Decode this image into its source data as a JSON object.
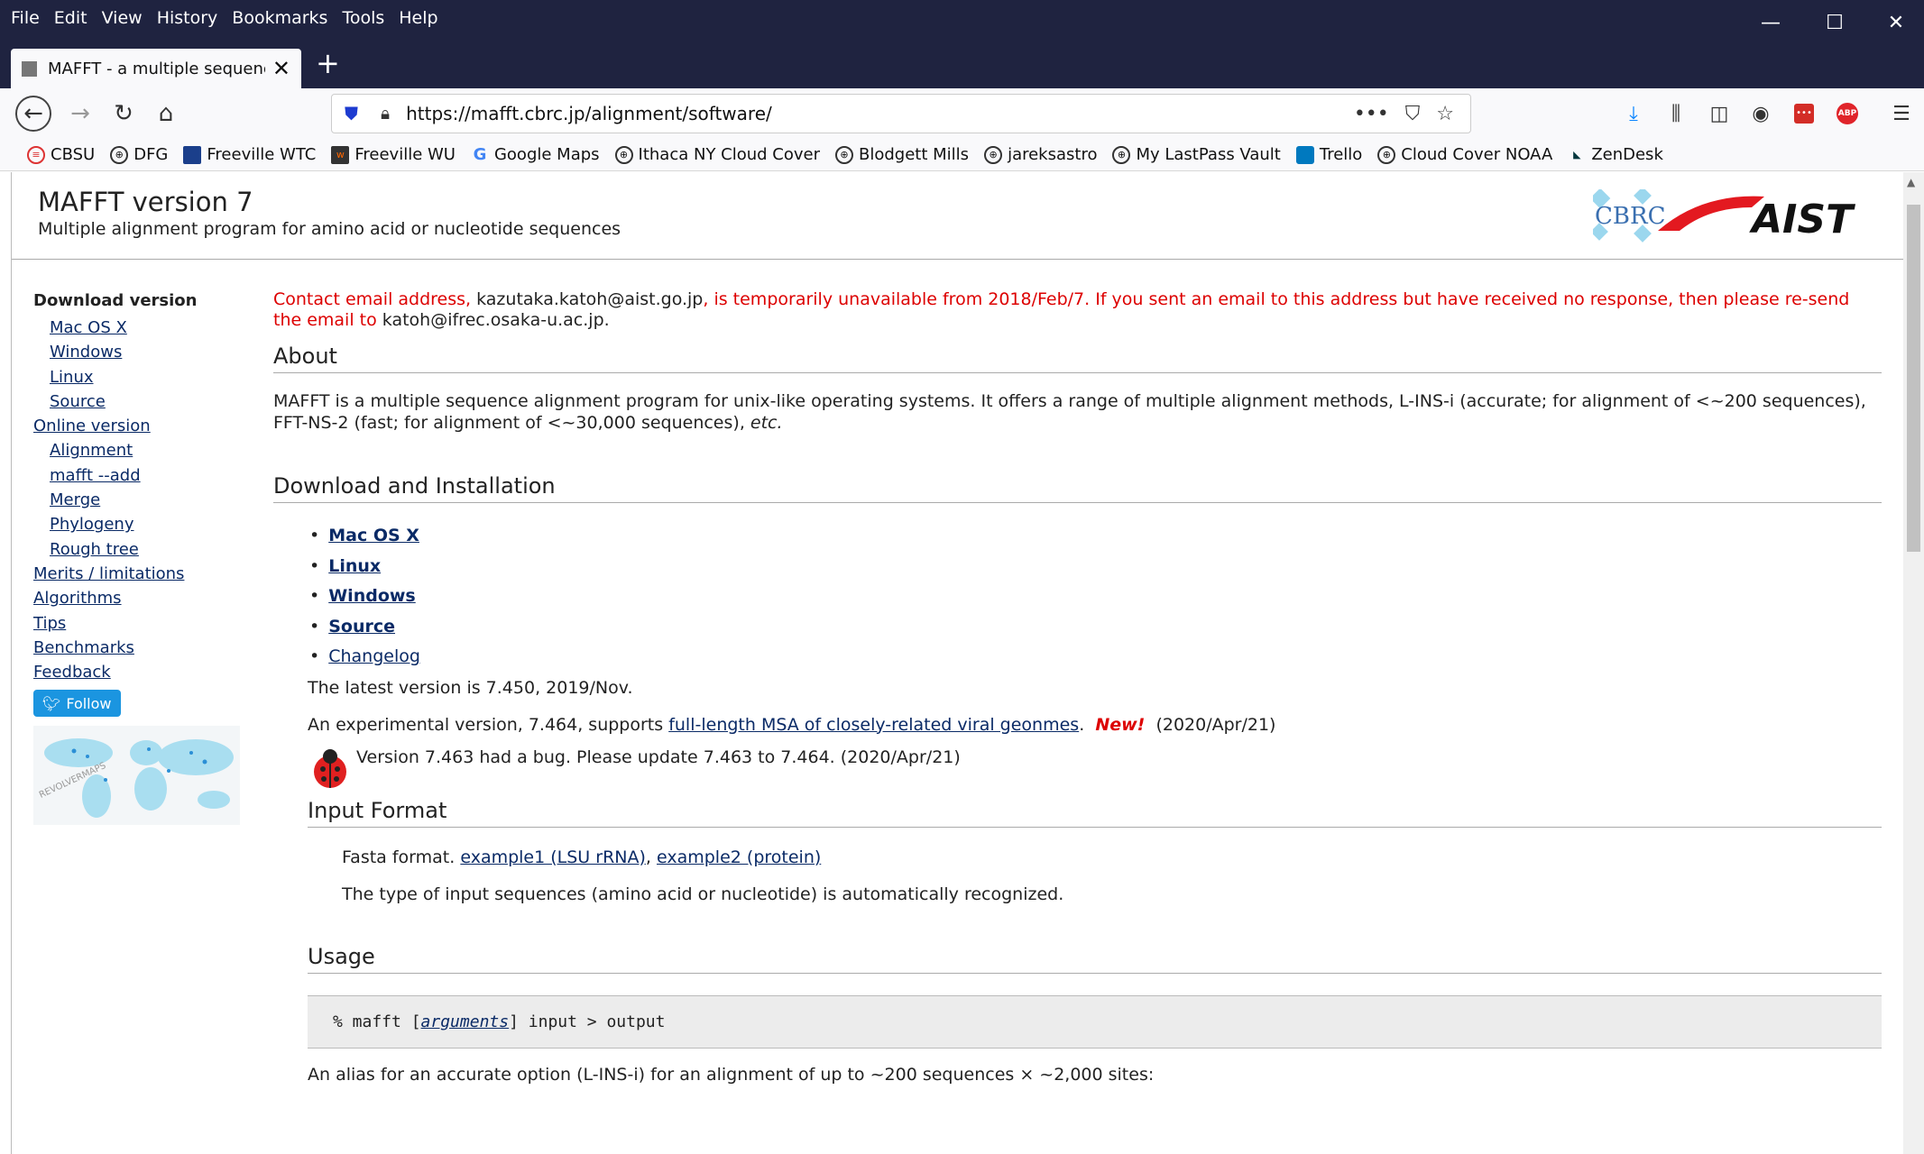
{
  "menu": [
    "File",
    "Edit",
    "View",
    "History",
    "Bookmarks",
    "Tools",
    "Help"
  ],
  "window_controls": {
    "minimize": "—",
    "maximize": "☐",
    "close": "✕"
  },
  "tab": {
    "title": "MAFFT - a multiple sequence a",
    "close": "✕",
    "new": "+"
  },
  "nav": {
    "url": "https://mafft.cbrc.jp/alignment/software/",
    "back": "←",
    "forward": "→",
    "reload": "↻",
    "home": "⌂",
    "more": "•••",
    "pocket": "⛉",
    "star": "☆"
  },
  "toolbar_icons": [
    "download-icon",
    "library-icon",
    "sidebar-icon",
    "account-icon",
    "lastpass-icon",
    "adblock-icon",
    "menu-icon"
  ],
  "bookmarks": [
    {
      "label": "CBSU"
    },
    {
      "label": "DFG"
    },
    {
      "label": "Freeville WTC"
    },
    {
      "label": "Freeville WU"
    },
    {
      "label": "Google Maps"
    },
    {
      "label": "Ithaca NY Cloud Cover"
    },
    {
      "label": "Blodgett Mills"
    },
    {
      "label": "jareksastro"
    },
    {
      "label": "My LastPass Vault"
    },
    {
      "label": "Trello"
    },
    {
      "label": "Cloud Cover NOAA"
    },
    {
      "label": "ZenDesk"
    }
  ],
  "header": {
    "title": "MAFFT version 7",
    "subtitle": "Multiple alignment program for amino acid or nucleotide sequences",
    "logo_left": "CBRC",
    "logo_right": "AIST"
  },
  "sidebar": {
    "download_heading": "Download version",
    "download_items": [
      "Mac OS X",
      "Windows",
      "Linux",
      "Source"
    ],
    "online_heading": "Online version",
    "online_items": [
      "Alignment",
      "mafft --add",
      "Merge",
      "Phylogeny",
      "Rough tree"
    ],
    "other_items": [
      "Merits / limitations",
      "Algorithms",
      "Tips",
      "Benchmarks",
      "Feedback"
    ],
    "follow": "Follow",
    "map_label": "REVOLVERMAPS"
  },
  "notice": {
    "p1": "Contact email address, ",
    "email1": "kazutaka.katoh@aist.go.jp",
    "p2": ", is temporarily unavailable from 2018/Feb/7.  If you sent an email to this address but have received no response, then please re-send the email to ",
    "email2": "katoh@ifrec.osaka-u.ac.jp."
  },
  "about": {
    "heading": "About",
    "text1": "MAFFT is a multiple sequence alignment program for unix-like operating systems.  It offers a range of multiple alignment methods, L-INS-i (accurate; for alignment of <~200 sequences), FFT-NS-2 (fast; for alignment of <~30,000 sequences), ",
    "etc": "etc."
  },
  "download": {
    "heading": "Download and Installation",
    "items": [
      "Mac OS X",
      "Linux",
      "Windows",
      "Source",
      "Changelog"
    ],
    "latest": "The latest version is 7.450, 2019/Nov.",
    "exp_pre": "An experimental version, 7.464, supports ",
    "exp_link": "full-length MSA of closely-related viral geonmes",
    "exp_dot": ".",
    "new": "New!",
    "exp_date": "(2020/Apr/21)",
    "bug": "Version 7.463 had a bug.  Please update 7.463 to 7.464.  (2020/Apr/21)"
  },
  "input": {
    "heading": "Input Format",
    "fasta": "Fasta format.  ",
    "ex1": "example1 (LSU rRNA)",
    "sep": ", ",
    "ex2": "example2 (protein)",
    "auto": "The type of input sequences (amino acid or nucleotide) is automatically recognized."
  },
  "usage": {
    "heading": "Usage",
    "code_pre": "% mafft [",
    "code_arg": "arguments",
    "code_post": "] input > output",
    "alias": "An alias for an accurate option (L-INS-i) for an alignment of up to ~200 sequences × ~2,000 sites:"
  }
}
